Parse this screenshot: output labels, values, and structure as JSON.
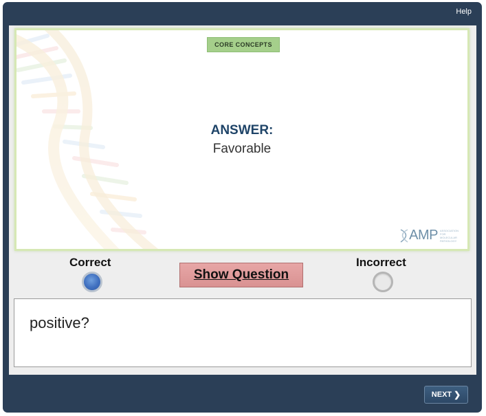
{
  "header": {
    "help_label": "Help"
  },
  "card": {
    "tag": "CORE CONCEPTS",
    "answer_label": "ANSWER:",
    "answer_text": "Favorable",
    "logo": {
      "mark": "AMP",
      "subtitle": "ASSOCIATION FOR MOLECULAR PATHOLOGY",
      "icon": "dna-logo-icon"
    }
  },
  "choices": {
    "correct": {
      "label": "Correct",
      "selected": true
    },
    "incorrect": {
      "label": "Incorrect",
      "selected": false
    }
  },
  "show_question_label": "Show Question",
  "question_text": "positive?",
  "footer": {
    "next_label": "NEXT",
    "next_icon": "chevron-right-icon"
  },
  "colors": {
    "frame": "#2b3f57",
    "answer_label": "#1f4468",
    "tag_bg": "#a5cf8b",
    "show_question_bg": "#e1a0a0",
    "radio_selected": "#3f6fbf"
  }
}
